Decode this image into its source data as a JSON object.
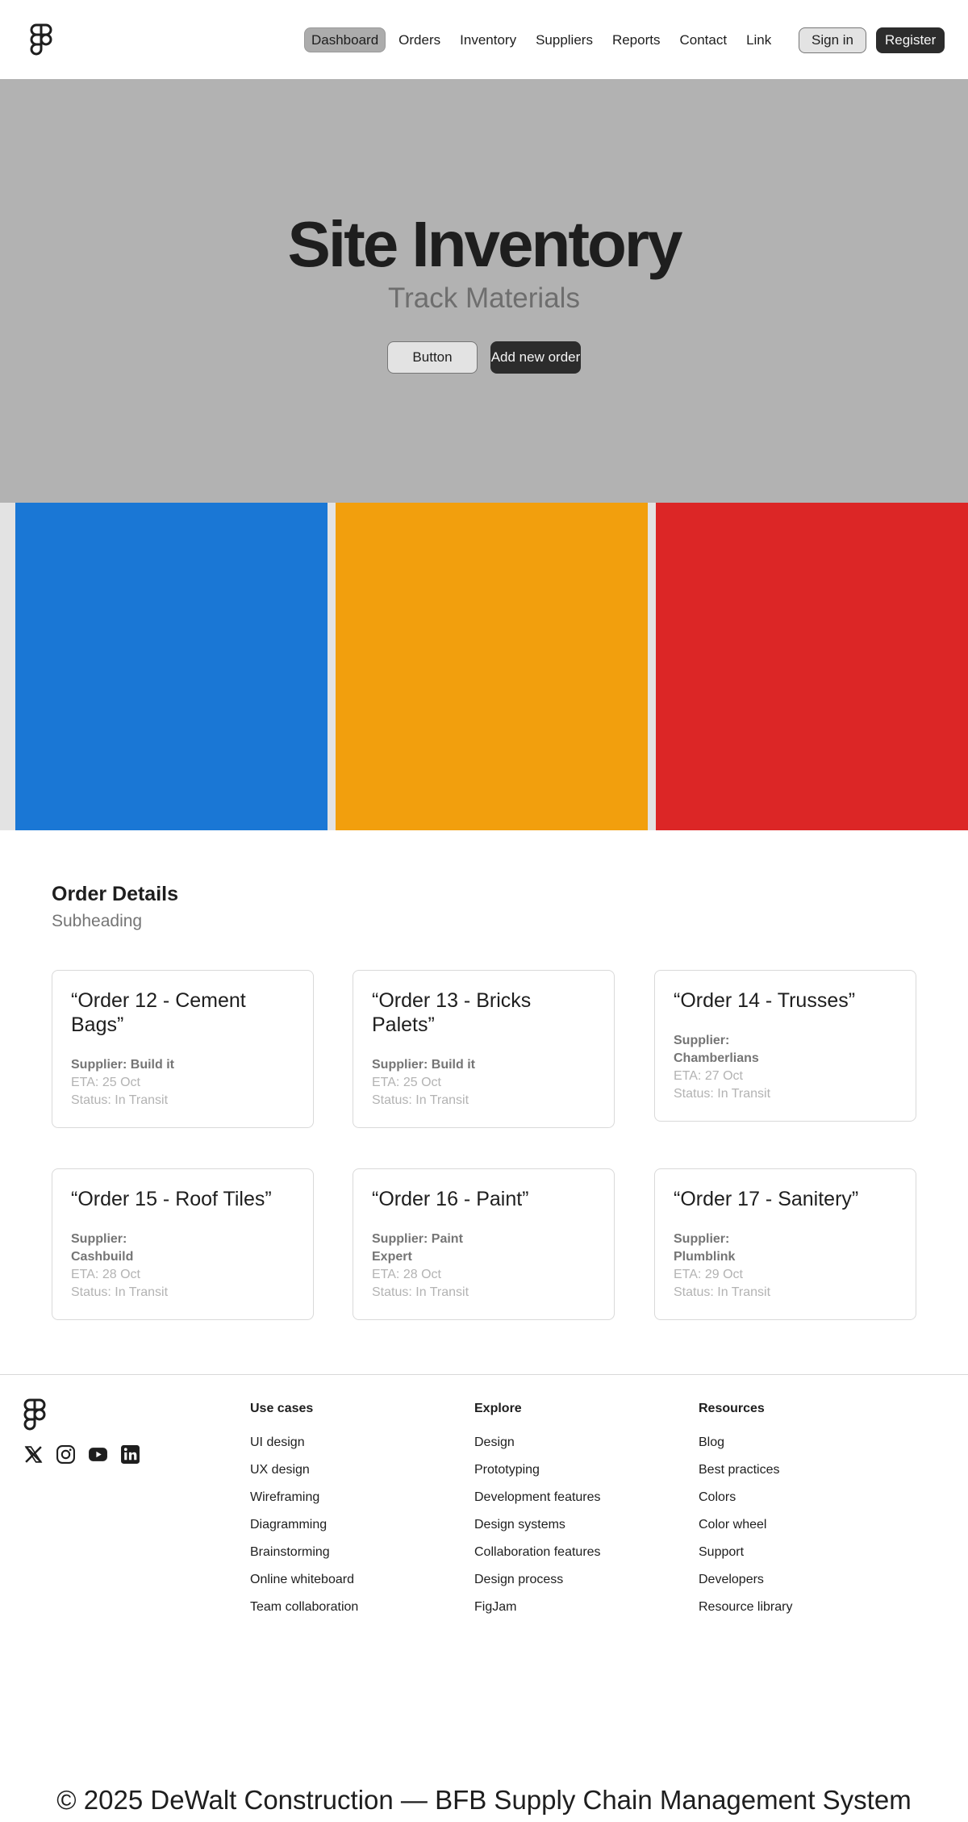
{
  "header": {
    "nav": [
      "Dashboard",
      "Orders",
      "Inventory",
      "Suppliers",
      "Reports",
      "Contact",
      "Link"
    ],
    "active_nav": "Dashboard",
    "sign_in": "Sign in",
    "register": "Register"
  },
  "hero": {
    "title": "Site Inventory",
    "subtitle": "Track Materials",
    "button_primary": "Button",
    "button_secondary": "Add new order"
  },
  "color_blocks": [
    "#1a77d5",
    "#f29f0d",
    "#dc2626"
  ],
  "orders": {
    "title": "Order Details",
    "subtitle": "Subheading",
    "cards": [
      {
        "title": "“Order 12 - Cement Bags”",
        "supplier": "Supplier: Build it",
        "eta": "ETA: 25 Oct",
        "status": "Status: In Transit"
      },
      {
        "title": "“Order 13 - Bricks Palets”",
        "supplier": "Supplier: Build it",
        "eta": "ETA: 25 Oct",
        "status": "Status: In Transit"
      },
      {
        "title": "“Order 14 - Trusses”",
        "supplier": "Supplier: Chamberlians",
        "eta": "ETA: 27 Oct",
        "status": "Status: In Transit"
      },
      {
        "title": "“Order 15 - Roof Tiles”",
        "supplier": "Supplier: Cashbuild",
        "eta": "ETA: 28 Oct",
        "status": "Status: In Transit"
      },
      {
        "title": "“Order 16 - Paint”",
        "supplier": "Supplier: Paint Expert",
        "eta": "ETA: 28 Oct",
        "status": "Status: In Transit"
      },
      {
        "title": "“Order 17 - Sanitery”",
        "supplier": "Supplier: Plumblink",
        "eta": "ETA: 29 Oct",
        "status": "Status: In Transit"
      }
    ]
  },
  "footer": {
    "socials": [
      "x-icon",
      "instagram-icon",
      "youtube-icon",
      "linkedin-icon"
    ],
    "columns": [
      {
        "title": "Use cases",
        "links": [
          "UI design",
          "UX design",
          "Wireframing",
          "Diagramming",
          "Brainstorming",
          "Online whiteboard",
          "Team collaboration"
        ]
      },
      {
        "title": "Explore",
        "links": [
          "Design",
          "Prototyping",
          "Development features",
          "Design systems",
          "Collaboration features",
          "Design process",
          "FigJam"
        ]
      },
      {
        "title": "Resources",
        "links": [
          "Blog",
          "Best practices",
          "Colors",
          "Color wheel",
          "Support",
          "Developers",
          "Resource library"
        ]
      }
    ],
    "copyright": "© 2025 DeWalt Construction — BFB Supply Chain Management System"
  }
}
